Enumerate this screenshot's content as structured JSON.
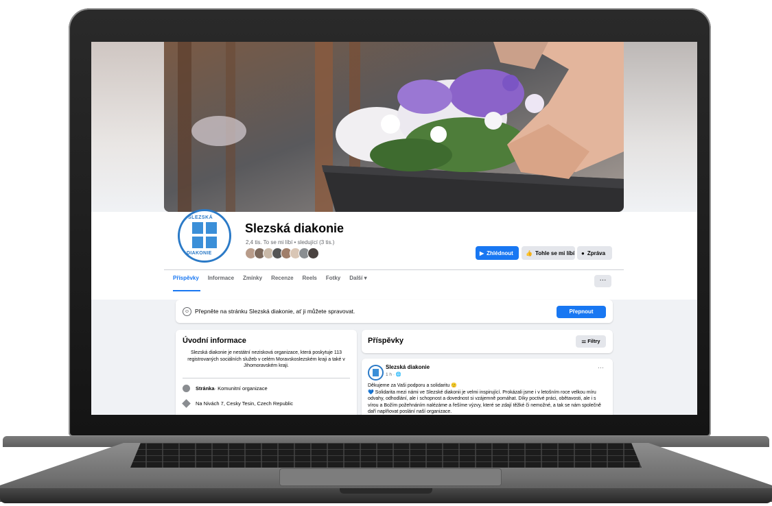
{
  "page": {
    "name": "Slezská diakonie",
    "stats": "2,4 tis. To se mi líbí • sledující (3 tis.)",
    "logo_top": "SLEZSKÁ",
    "logo_bottom": "DIAKONIE"
  },
  "actions": {
    "watch": "Zhlédnout",
    "like": "Tohle se mi líbí",
    "message": "Zpráva"
  },
  "tabs": [
    {
      "label": "Příspěvky",
      "active": true
    },
    {
      "label": "Informace"
    },
    {
      "label": "Zmínky"
    },
    {
      "label": "Recenze"
    },
    {
      "label": "Reels"
    },
    {
      "label": "Fotky"
    },
    {
      "label": "Další ▾"
    }
  ],
  "more_button": "···",
  "switch_banner": {
    "text": "Přepněte na stránku Slezská diakonie, ať ji můžete spravovat.",
    "button": "Přepnout"
  },
  "intro": {
    "title": "Úvodní informace",
    "description": "Slezská diakonie je nestátní nezisková organizace, která poskytuje 113 registrovaných sociálních služeb v celém Moravskoslezském kraji a také v Jihomoravském kraji.",
    "category_label": "Stránka",
    "category_value": " · Komunitní organizace",
    "address": "Na Nivách 7, Cesky Tesin, Czech Republic"
  },
  "posts": {
    "title": "Příspěvky",
    "filters": "Filtry",
    "post": {
      "author": "Slezská diakonie",
      "time": "1 h · 🌐",
      "line1": "Děkujeme za Vaši podporu a solidaritu 🙂",
      "line2": "💙 Solidarita mezi námi ve Slezské diakonii je velmi inspirující. Prokázali jsme i v letošním roce velkou míru odvahy, odhodlání, ale i schopnost a dovednost si vzájemně pomáhat. Díky poctivé práci, obětavosti, ale i s vírou a Božím požehnáním nalézáme a řešíme výzvy, které se zdají těžké či nemožné, a tak se nám společně daří naplňovat poslání naší organizace."
    }
  }
}
